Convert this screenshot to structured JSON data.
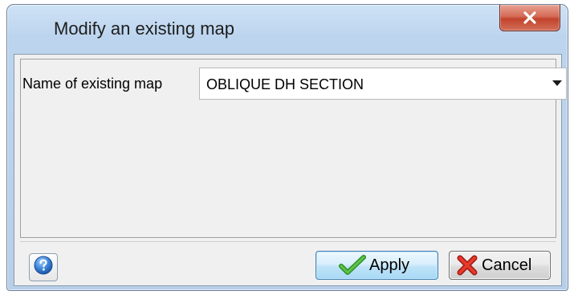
{
  "window": {
    "title": "Modify an existing map",
    "close_icon": "close-icon"
  },
  "form": {
    "map_label": "Name of existing map",
    "map_value": "OBLIQUE DH SECTION",
    "dropdown_icon": "chevron-down-icon"
  },
  "buttons": {
    "help_icon": "help-icon",
    "apply_label": "Apply",
    "apply_icon": "checkmark-icon",
    "cancel_label": "Cancel",
    "cancel_icon": "x-icon"
  },
  "colors": {
    "close_button": "#c9462f",
    "apply_accent": "#a7d9f5",
    "checkmark": "#3aa32c",
    "cancel_x": "#d22a1e"
  }
}
